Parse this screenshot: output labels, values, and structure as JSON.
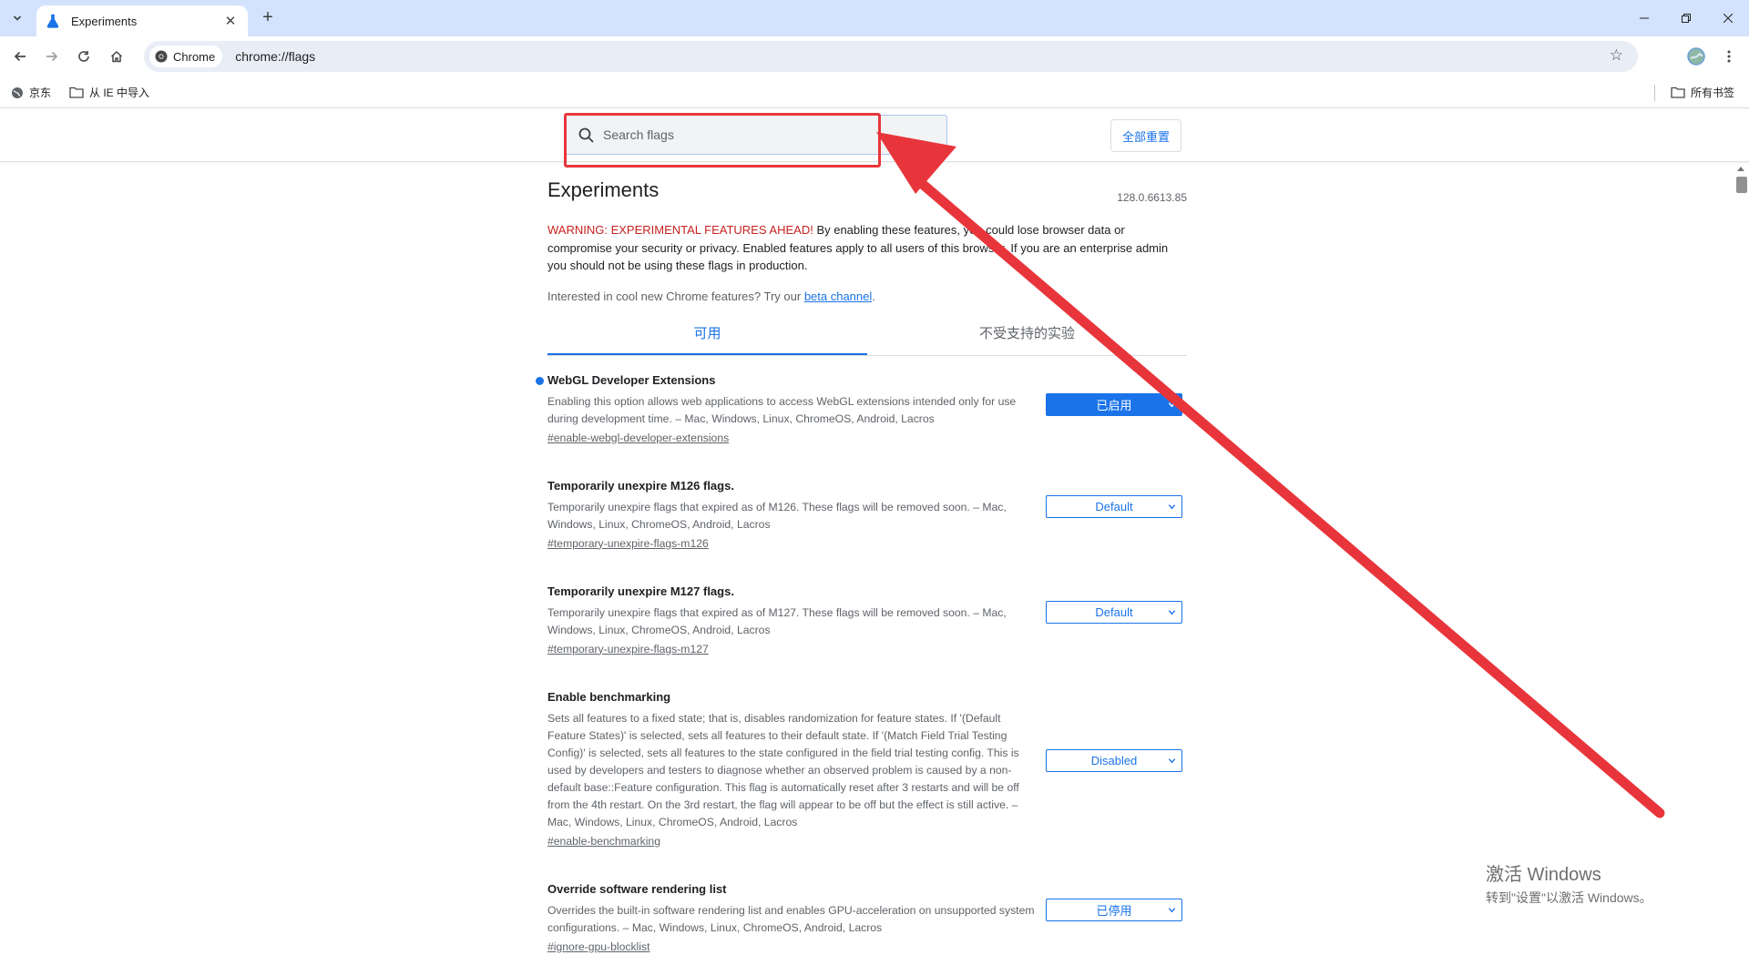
{
  "window": {
    "tab_title": "Experiments",
    "new_tab_symbol": "+"
  },
  "toolbar": {
    "chip_label": "Chrome",
    "url": "chrome://flags"
  },
  "bookmarks": {
    "items": [
      {
        "label": "京东",
        "icon": "globe-icon"
      },
      {
        "label": "从 IE 中导入",
        "icon": "folder-icon"
      }
    ],
    "all_bookmarks": "所有书签"
  },
  "header": {
    "search_placeholder": "Search flags",
    "reset_label": "全部重置"
  },
  "page": {
    "title": "Experiments",
    "version": "128.0.6613.85",
    "warning_red": "WARNING: EXPERIMENTAL FEATURES AHEAD!",
    "warning_rest": " By enabling these features, you could lose browser data or compromise your security or privacy. Enabled features apply to all users of this browser. If you are an enterprise admin you should not be using these flags in production.",
    "interest_text": "Interested in cool new Chrome features? Try our ",
    "interest_link": "beta channel",
    "interest_end": "."
  },
  "tabs": [
    {
      "label": "可用",
      "active": true
    },
    {
      "label": "不受支持的实验",
      "active": false
    }
  ],
  "experiments": [
    {
      "name": "WebGL Developer Extensions",
      "desc": "Enabling this option allows web applications to access WebGL extensions intended only for use during development time. – Mac, Windows, Linux, ChromeOS, Android, Lacros",
      "link": "#enable-webgl-developer-extensions",
      "value": "已启用",
      "modified": true
    },
    {
      "name": "Temporarily unexpire M126 flags.",
      "desc": "Temporarily unexpire flags that expired as of M126. These flags will be removed soon. – Mac, Windows, Linux, ChromeOS, Android, Lacros",
      "link": "#temporary-unexpire-flags-m126",
      "value": "Default",
      "modified": false
    },
    {
      "name": "Temporarily unexpire M127 flags.",
      "desc": "Temporarily unexpire flags that expired as of M127. These flags will be removed soon. – Mac, Windows, Linux, ChromeOS, Android, Lacros",
      "link": "#temporary-unexpire-flags-m127",
      "value": "Default",
      "modified": false
    },
    {
      "name": "Enable benchmarking",
      "desc": "Sets all features to a fixed state; that is, disables randomization for feature states. If '(Default Feature States)' is selected, sets all features to their default state. If '(Match Field Trial Testing Config)' is selected, sets all features to the state configured in the field trial testing config. This is used by developers and testers to diagnose whether an observed problem is caused by a non-default base::Feature configuration. This flag is automatically reset after 3 restarts and will be off from the 4th restart. On the 3rd restart, the flag will appear to be off but the effect is still active. – Mac, Windows, Linux, ChromeOS, Android, Lacros",
      "link": "#enable-benchmarking",
      "value": "Disabled",
      "modified": false
    },
    {
      "name": "Override software rendering list",
      "desc": "Overrides the built-in software rendering list and enables GPU-acceleration on unsupported system configurations. – Mac, Windows, Linux, ChromeOS, Android, Lacros",
      "link": "#ignore-gpu-blocklist",
      "value": "已停用",
      "modified": false
    }
  ],
  "watermark": {
    "line1": "激活 Windows",
    "line2": "转到\"设置\"以激活 Windows。"
  },
  "annotation": {
    "color": "#e8353b"
  }
}
